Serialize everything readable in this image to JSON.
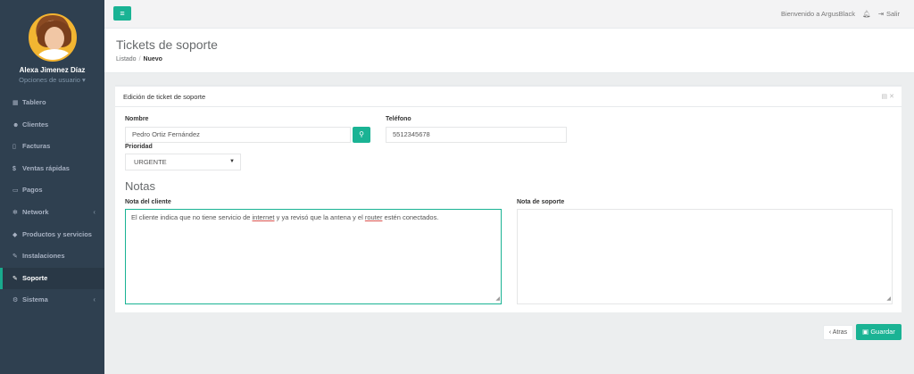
{
  "sidebar": {
    "user_name": "Alexa Jimenez Díaz",
    "user_options": "Opciones de usuario ▾",
    "items": [
      {
        "label": "Tablero",
        "icon": "dashboard-icon"
      },
      {
        "label": "Clientes",
        "icon": "users-icon"
      },
      {
        "label": "Facturas",
        "icon": "file-icon"
      },
      {
        "label": "Ventas rápidas",
        "icon": "dollar-icon"
      },
      {
        "label": "Pagos",
        "icon": "money-icon"
      },
      {
        "label": "Network",
        "icon": "sitemap-icon",
        "arrow": "‹"
      },
      {
        "label": "Productos y servicios",
        "icon": "tag-icon"
      },
      {
        "label": "Instalaciones",
        "icon": "wrench-icon"
      },
      {
        "label": "Soporte",
        "icon": "wrench-icon",
        "active": true
      },
      {
        "label": "Sistema",
        "icon": "cogs-icon",
        "arrow": "‹"
      }
    ]
  },
  "topbar": {
    "welcome": "Bienvenido a ArgusBlack",
    "logout": "Salir"
  },
  "heading": {
    "title": "Tickets de soporte",
    "crumb_list": "Listado",
    "crumb_sep": "/",
    "crumb_current": "Nuevo"
  },
  "panel": {
    "title": "Edición de ticket de soporte",
    "nombre_label": "Nombre",
    "nombre_value": "Pedro Ortiz Fernández",
    "telefono_label": "Teléfono",
    "telefono_value": "5512345678",
    "prioridad_label": "Prioridad",
    "prioridad_value": "URGENTE",
    "notas_title": "Notas",
    "nota_cliente_label": "Nota del cliente",
    "nota_cliente_part1": "El cliente indica que no tiene servicio de ",
    "nota_cliente_word1": "internet",
    "nota_cliente_part2": " y ya revisó que la antena y el ",
    "nota_cliente_word2": "router",
    "nota_cliente_part3": " estén conectados.",
    "nota_soporte_label": "Nota de soporte",
    "nota_soporte_value": ""
  },
  "actions": {
    "back": "‹ Atras",
    "save": "Guardar"
  },
  "colors": {
    "accent": "#1ab394",
    "sidebar_bg": "#2f4050"
  }
}
